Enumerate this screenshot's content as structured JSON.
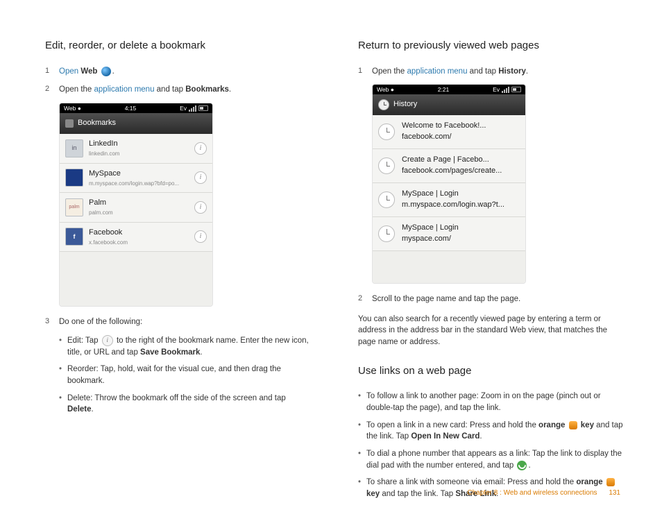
{
  "left": {
    "heading": "Edit, reorder, or delete a bookmark",
    "steps": {
      "s1": {
        "num": "1",
        "open": "Open ",
        "bold": "Web",
        "period": "."
      },
      "s2": {
        "num": "2",
        "open_the": "Open the ",
        "link": "application menu",
        "and_tap": " and tap ",
        "bold": "Bookmarks",
        "period": "."
      },
      "s3": {
        "num": "3",
        "text": "Do one of the following:"
      }
    },
    "bullets": {
      "b1a": "Edit: Tap ",
      "b1b": " to the right of the bookmark name. Enter the new icon, title, or URL and tap ",
      "b1bold": "Save Bookmark",
      "b1c": ".",
      "b2": "Reorder: Tap, hold, wait for the visual cue, and then drag the bookmark.",
      "b3a": "Delete: Throw the bookmark off the side of the screen and tap ",
      "b3bold": "Delete",
      "b3b": "."
    }
  },
  "right": {
    "heading": "Return to previously viewed web pages",
    "step1": {
      "num": "1",
      "open_the": "Open the ",
      "link": "application menu",
      "and_tap": " and tap ",
      "bold": "History",
      "period": "."
    },
    "step2": {
      "num": "2",
      "text": "Scroll to the page name and tap the page."
    },
    "para": "You can also search for a recently viewed page by entering a term or address in the address bar in the standard Web view, that matches the page name or address.",
    "heading2": "Use links on a web page",
    "bullets": {
      "b1": "To follow a link to another page: Zoom in on the page (pinch out or double-tap the page), and tap the link.",
      "b2a": "To open a link in a new card: Press and hold the ",
      "b2orange": "orange",
      "b2key": " key",
      "b2b": " and tap the link. Tap ",
      "b2bold": "Open In New Card",
      "b2c": ".",
      "b3a": "To dial a phone number that appears as a link: Tap the link to display the dial pad with the number entered, and tap ",
      "b3b": ".",
      "b4a": "To share a link with someone via email: Press and hold the ",
      "b4orange": "orange",
      "b4key": " key",
      "b4b": " and tap the link. Tap ",
      "b4bold": "Share Link",
      "b4c": "."
    }
  },
  "phone_bookmarks": {
    "status_app": "Web",
    "status_dot": "●",
    "status_time": "4:15",
    "status_ev": "Ev",
    "header": "Bookmarks",
    "rows": [
      {
        "title": "LinkedIn",
        "sub": "linkedin.com"
      },
      {
        "title": "MySpace",
        "sub": "m.myspace.com/login.wap?bfd=po..."
      },
      {
        "title": "Palm",
        "sub": "palm.com"
      },
      {
        "title": "Facebook",
        "sub": "x.facebook.com"
      }
    ]
  },
  "phone_history": {
    "status_app": "Web",
    "status_dot": "●",
    "status_time": "2:21",
    "status_ev": "Ev",
    "header": "History",
    "rows": [
      {
        "title": "Welcome to Facebook!...",
        "sub": "facebook.com/"
      },
      {
        "title": "Create a Page | Facebo...",
        "sub": "facebook.com/pages/create..."
      },
      {
        "title": "MySpace | Login",
        "sub": "m.myspace.com/login.wap?t..."
      },
      {
        "title": "MySpace | Login",
        "sub": "myspace.com/"
      }
    ]
  },
  "footer": {
    "chapter": "Chapter 8 : Web and wireless connections",
    "page": "131"
  },
  "thumb_labels": {
    "linkedin": "in",
    "palm": "palm",
    "fb": "f"
  }
}
